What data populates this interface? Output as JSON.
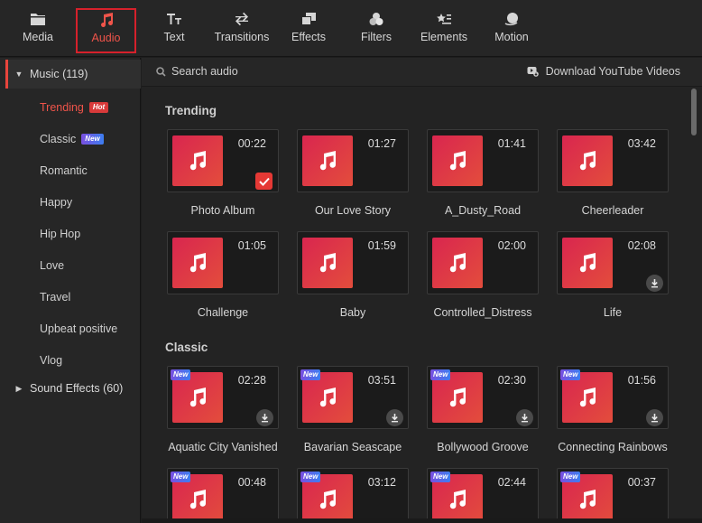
{
  "toolbar": {
    "items": [
      {
        "label": "Media",
        "icon": "folder-icon"
      },
      {
        "label": "Audio",
        "icon": "music-note-icon",
        "active": true
      },
      {
        "label": "Text",
        "icon": "text-icon"
      },
      {
        "label": "Transitions",
        "icon": "transitions-icon"
      },
      {
        "label": "Effects",
        "icon": "effects-icon"
      },
      {
        "label": "Filters",
        "icon": "filters-icon"
      },
      {
        "label": "Elements",
        "icon": "elements-icon"
      },
      {
        "label": "Motion",
        "icon": "motion-icon"
      }
    ]
  },
  "sidebar": {
    "music_header": "Music (119)",
    "items": [
      {
        "label": "Trending",
        "badge": "Hot",
        "active": true
      },
      {
        "label": "Classic",
        "badge": "New"
      },
      {
        "label": "Romantic"
      },
      {
        "label": "Happy"
      },
      {
        "label": "Hip Hop"
      },
      {
        "label": "Love"
      },
      {
        "label": "Travel"
      },
      {
        "label": "Upbeat positive"
      },
      {
        "label": "Vlog"
      }
    ],
    "sound_effects_header": "Sound Effects (60)"
  },
  "main": {
    "search_placeholder": "Search audio",
    "download_youtube": "Download YouTube Videos",
    "sections": [
      {
        "title": "Trending"
      },
      {
        "title": "Classic"
      }
    ],
    "trending": [
      {
        "name": "Photo Album",
        "duration": "00:22",
        "state": "added"
      },
      {
        "name": "Our Love Story",
        "duration": "01:27"
      },
      {
        "name": "A_Dusty_Road",
        "duration": "01:41"
      },
      {
        "name": "Cheerleader",
        "duration": "03:42"
      },
      {
        "name": "Challenge",
        "duration": "01:05"
      },
      {
        "name": "Baby",
        "duration": "01:59"
      },
      {
        "name": "Controlled_Distress",
        "duration": "02:00"
      },
      {
        "name": "Life",
        "duration": "02:08",
        "state": "download"
      }
    ],
    "classic": [
      {
        "name": "Aquatic City Vanished",
        "duration": "02:28",
        "new": "New",
        "state": "download"
      },
      {
        "name": "Bavarian Seascape",
        "duration": "03:51",
        "new": "New",
        "state": "download"
      },
      {
        "name": "Bollywood Groove",
        "duration": "02:30",
        "new": "New",
        "state": "download"
      },
      {
        "name": "Connecting Rainbows",
        "duration": "01:56",
        "new": "New",
        "state": "download"
      },
      {
        "duration": "00:48",
        "new": "New"
      },
      {
        "duration": "03:12",
        "new": "New"
      },
      {
        "duration": "02:44",
        "new": "New"
      },
      {
        "duration": "00:37",
        "new": "New"
      }
    ]
  },
  "colors": {
    "accent": "#e8453c",
    "thumb_start": "#d9264f",
    "thumb_end": "#e34d3c"
  }
}
